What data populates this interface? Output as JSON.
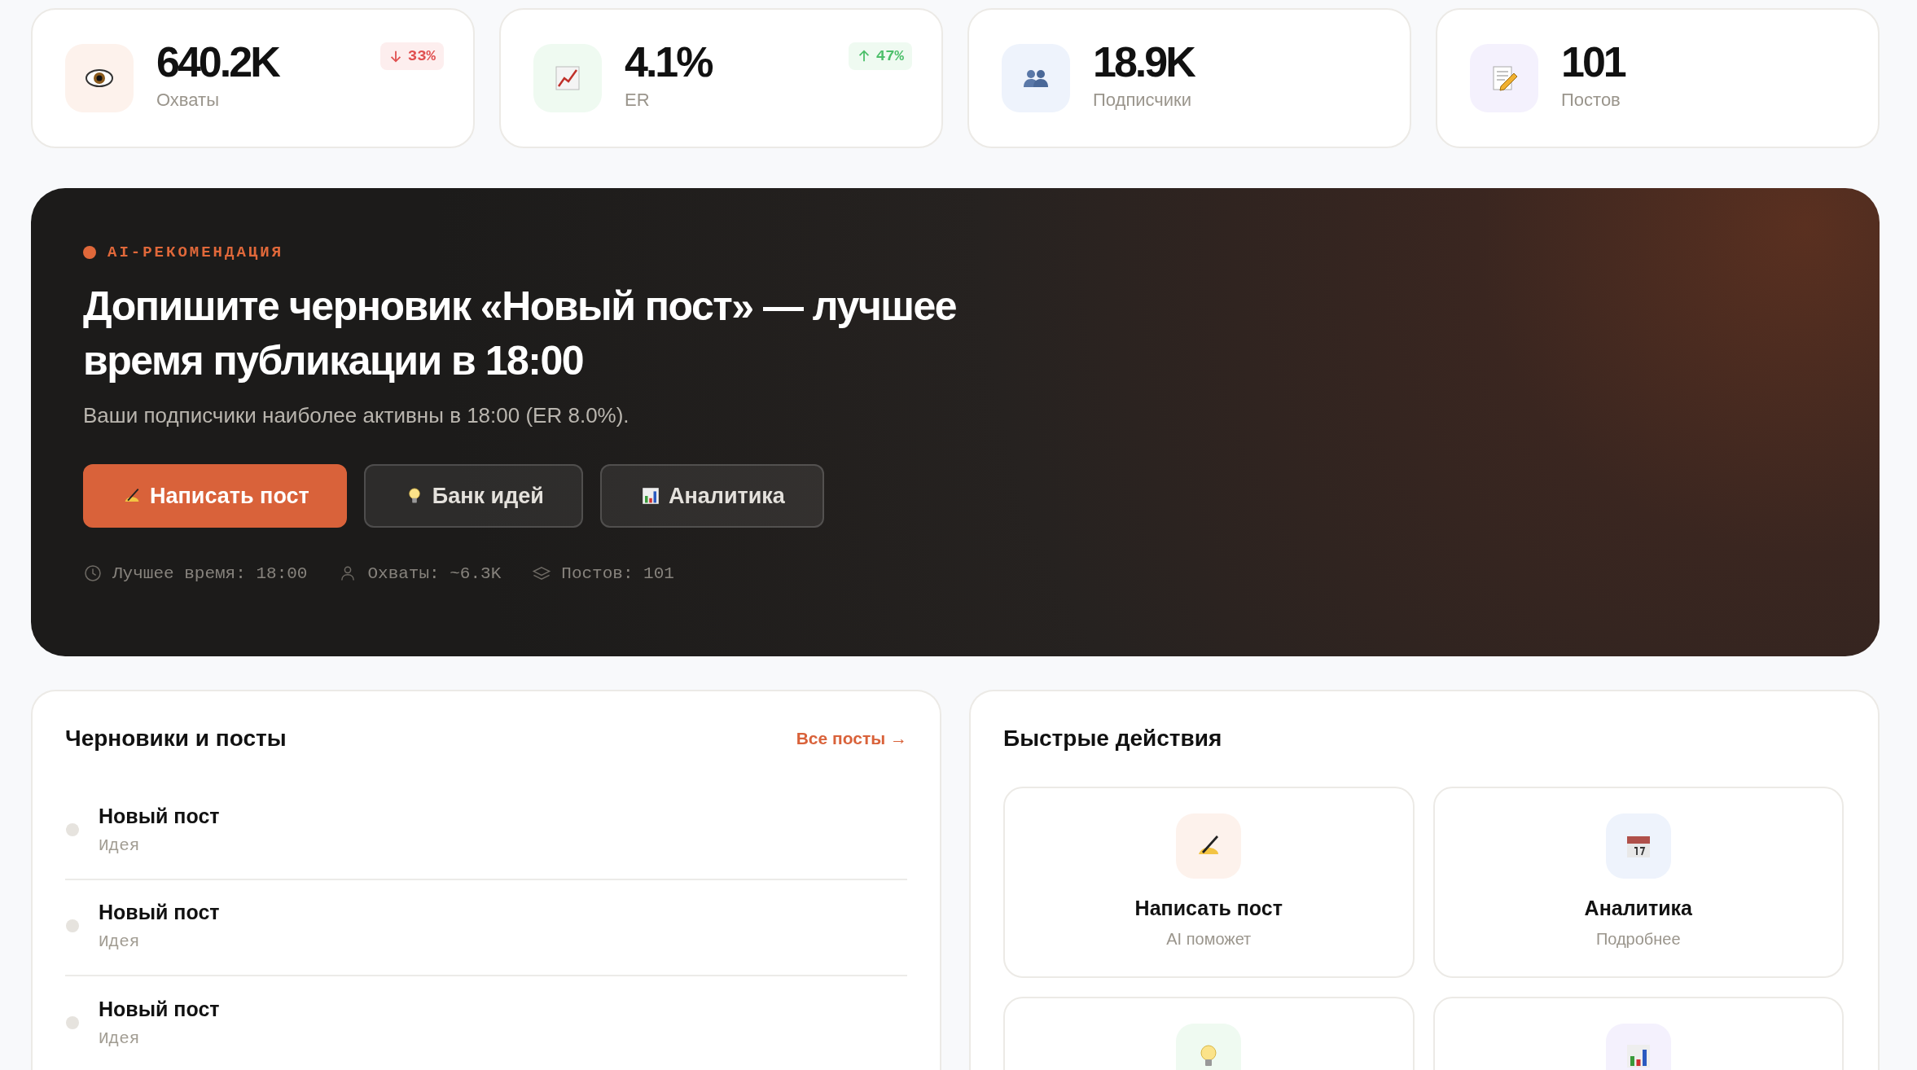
{
  "stats": [
    {
      "value": "640.2K",
      "label": "Охваты",
      "color": "#fdf2ec",
      "badge": {
        "kind": "down",
        "text": "33%"
      }
    },
    {
      "value": "4.1%",
      "label": "ER",
      "color": "#effaf1",
      "badge": {
        "kind": "up",
        "text": "47%"
      }
    },
    {
      "value": "18.9K",
      "label": "Подписчики",
      "color": "#eef3fc"
    },
    {
      "value": "101",
      "label": "Постов",
      "color": "#f4f1fd"
    }
  ],
  "hero": {
    "tag": "AI-РЕКОМЕНДАЦИЯ",
    "title": "Допишите черновик «Новый пост» — лучшее время публикации в 18:00",
    "subtitle": "Ваши подписчики наиболее активны в 18:00 (ER 8.0%).",
    "buttons": [
      {
        "label": "Написать пост",
        "kind": "primary"
      },
      {
        "label": "Банк идей",
        "kind": "ghost"
      },
      {
        "label": "Аналитика",
        "kind": "ghost"
      }
    ],
    "meta": [
      "Лучшее время: 18:00",
      "Охваты: ~6.3K",
      "Постов: 101"
    ]
  },
  "posts": {
    "title": "Черновики и посты",
    "link": "Все посты →",
    "items": [
      {
        "title": "Новый пост",
        "status": "Идея",
        "color": "#e6e3de"
      },
      {
        "title": "Новый пост",
        "status": "Идея",
        "color": "#e6e3de"
      },
      {
        "title": "Новый пост",
        "status": "Идея",
        "color": "#e6e3de"
      }
    ]
  },
  "actions": {
    "title": "Быстрые действия",
    "items": [
      {
        "title": "Написать пост",
        "subtitle": "AI поможет",
        "color": "#fdf2ec"
      },
      {
        "title": "Аналитика",
        "subtitle": "Подробнее",
        "color": "#eef3fc"
      },
      {
        "color": "#effaf1"
      },
      {
        "color": "#f4f1fd"
      }
    ]
  }
}
